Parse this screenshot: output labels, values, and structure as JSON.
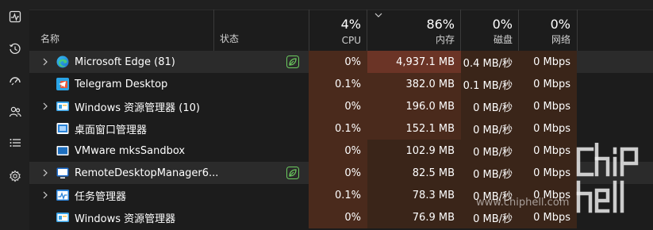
{
  "sidebar": {
    "items": [
      {
        "name": "performance-icon"
      },
      {
        "name": "history-icon"
      },
      {
        "name": "startup-icon"
      },
      {
        "name": "users-icon"
      },
      {
        "name": "details-icon"
      },
      {
        "name": "services-icon"
      }
    ]
  },
  "header": {
    "name_label": "名称",
    "status_label": "状态",
    "cpu": {
      "percent": "4%",
      "label": "CPU"
    },
    "memory": {
      "percent": "86%",
      "label": "内存"
    },
    "disk": {
      "percent": "0%",
      "label": "磁盘"
    },
    "network": {
      "percent": "0%",
      "label": "网络"
    }
  },
  "processes": [
    {
      "name": "Microsoft Edge (81)",
      "icon": "edge-icon",
      "expandable": true,
      "efficiency": true,
      "cpu": "0%",
      "memory": "4,937.1 MB",
      "disk": "0.4 MB/秒",
      "network": "0 Mbps"
    },
    {
      "name": "Telegram Desktop",
      "icon": "telegram-icon",
      "expandable": false,
      "efficiency": false,
      "cpu": "0.1%",
      "memory": "382.0 MB",
      "disk": "0.1 MB/秒",
      "network": "0 Mbps"
    },
    {
      "name": "Windows 资源管理器 (10)",
      "icon": "explorer-icon",
      "expandable": true,
      "efficiency": false,
      "cpu": "0%",
      "memory": "196.0 MB",
      "disk": "0 MB/秒",
      "network": "0 Mbps"
    },
    {
      "name": "桌面窗口管理器",
      "icon": "dwm-icon",
      "expandable": false,
      "efficiency": false,
      "cpu": "0.1%",
      "memory": "152.1 MB",
      "disk": "0 MB/秒",
      "network": "0 Mbps"
    },
    {
      "name": "VMware mksSandbox",
      "icon": "vmware-icon",
      "expandable": false,
      "efficiency": false,
      "cpu": "0%",
      "memory": "102.9 MB",
      "disk": "0 MB/秒",
      "network": "0 Mbps"
    },
    {
      "name": "RemoteDesktopManager6...",
      "icon": "remote-desktop-icon",
      "expandable": true,
      "efficiency": true,
      "cpu": "0%",
      "memory": "82.5 MB",
      "disk": "0 MB/秒",
      "network": "0 Mbps"
    },
    {
      "name": "任务管理器",
      "icon": "task-manager-icon",
      "expandable": true,
      "efficiency": false,
      "cpu": "0.1%",
      "memory": "78.3 MB",
      "disk": "0 MB/秒",
      "network": "0 Mbps"
    },
    {
      "name": "Windows 资源管理器",
      "icon": "explorer-icon",
      "expandable": false,
      "efficiency": false,
      "cpu": "0%",
      "memory": "76.9 MB",
      "disk": "0 MB/秒",
      "network": "0 Mbps"
    }
  ],
  "watermark": {
    "text": "www.chiphell.com",
    "logo_text": "chip hell"
  },
  "colors": {
    "background": "#1c1c1c",
    "sidebar": "#202020",
    "heat_low": "#3a2519",
    "heat_med": "#4a2a1c",
    "heat_high": "#6b3426",
    "efficiency_green": "#6ccb5f"
  }
}
